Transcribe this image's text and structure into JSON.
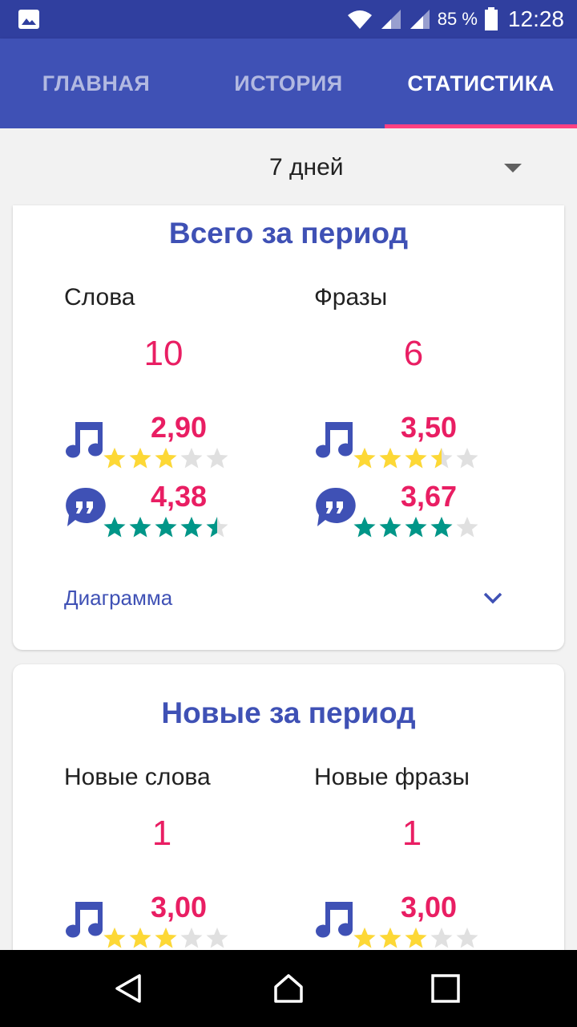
{
  "status_bar": {
    "battery_percent": "85 %",
    "time": "12:28",
    "icons": [
      "image-icon",
      "wifi-icon",
      "signal-icon",
      "signal-icon",
      "battery-icon"
    ]
  },
  "tabs": [
    {
      "label": "ГЛАВНАЯ",
      "active": false
    },
    {
      "label": "ИСТОРИЯ",
      "active": false
    },
    {
      "label": "СТАТИСТИКА",
      "active": true
    }
  ],
  "colors": {
    "primary": "#3f51b5",
    "primary_dark": "#303f9f",
    "accent": "#ff4081",
    "number": "#e91e63",
    "star_gold": "#fdd835",
    "star_teal": "#009688",
    "star_empty": "#e0e0e0"
  },
  "period": {
    "selected": "7 дней"
  },
  "total_card": {
    "title": "Всего за период",
    "words": {
      "label": "Слова",
      "count": "10",
      "listening": {
        "value": "2,90",
        "rating": 3.0,
        "icon": "music-note-icon"
      },
      "speech": {
        "value": "4,38",
        "rating": 4.5,
        "icon": "quote-bubble-icon"
      }
    },
    "phrases": {
      "label": "Фразы",
      "count": "6",
      "listening": {
        "value": "3,50",
        "rating": 3.5,
        "icon": "music-note-icon"
      },
      "speech": {
        "value": "3,67",
        "rating": 4.0,
        "icon": "quote-bubble-icon"
      }
    },
    "diagram_label": "Диаграмма"
  },
  "new_card": {
    "title": "Новые за период",
    "words": {
      "label": "Новые слова",
      "count": "1",
      "listening": {
        "value": "3,00",
        "rating": 3.0,
        "icon": "music-note-icon"
      }
    },
    "phrases": {
      "label": "Новые фразы",
      "count": "1",
      "listening": {
        "value": "3,00",
        "rating": 3.0,
        "icon": "music-note-icon"
      }
    }
  },
  "nav_bar": [
    "back-icon",
    "home-icon",
    "recents-icon"
  ]
}
